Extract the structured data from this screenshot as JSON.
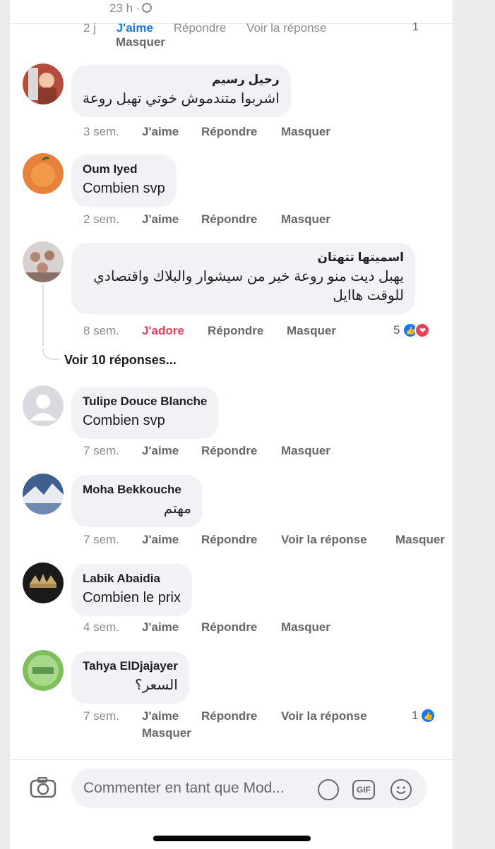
{
  "header": {
    "time": "23 h ·",
    "partial_actions": [
      "2 j",
      "J'aime",
      "Répondre",
      "Voir la réponse"
    ],
    "partial_hide": "Masquer",
    "partial_count": "1"
  },
  "comments": [
    {
      "author": "رحيل رسيم",
      "text": "اشربوا متندموش خوتي تهبل روعة",
      "time": "3 sem.",
      "like": "J'aime",
      "reply": "Répondre",
      "hide": "Masquer"
    },
    {
      "author": "Oum Iyed",
      "text": "Combien svp",
      "time": "2 sem.",
      "like": "J'aime",
      "reply": "Répondre",
      "hide": "Masquer"
    },
    {
      "author": "اسميتها تتهتان",
      "text_line1": "يهبل ديت منو روعة خير من سيشوار والبلاك واقتصادي",
      "text_line2": "للوقت هاايل",
      "time": "8 sem.",
      "like": "J'adore",
      "reply": "Répondre",
      "hide": "Masquer",
      "reaction_count": "5",
      "more_replies": "Voir 10 réponses..."
    },
    {
      "author": "Tulipe Douce Blanche",
      "text": "Combien svp",
      "time": "7 sem.",
      "like": "J'aime",
      "reply": "Répondre",
      "hide": "Masquer"
    },
    {
      "author": "Moha Bekkouche",
      "text": "مهتم",
      "time": "7 sem.",
      "like": "J'aime",
      "reply": "Répondre",
      "view_reply": "Voir la réponse",
      "hide": "Masquer"
    },
    {
      "author": "Labik Abaidia",
      "text": "Combien le prix",
      "time": "4 sem.",
      "like": "J'aime",
      "reply": "Répondre",
      "hide": "Masquer"
    },
    {
      "author": "Tahya ElDjajayer",
      "text": "السعر؟",
      "time": "7 sem.",
      "like": "J'aime",
      "reply": "Répondre",
      "view_reply": "Voir la réponse",
      "hide": "Masquer",
      "reaction_count": "1"
    }
  ],
  "composer": {
    "placeholder": "Commenter en tant que Mod...",
    "gif_label": "GIF"
  },
  "colors": {
    "accent": "#1877f2",
    "love": "#f33e58",
    "bubble": "#f0f2f5",
    "meta": "#8a8d91"
  }
}
